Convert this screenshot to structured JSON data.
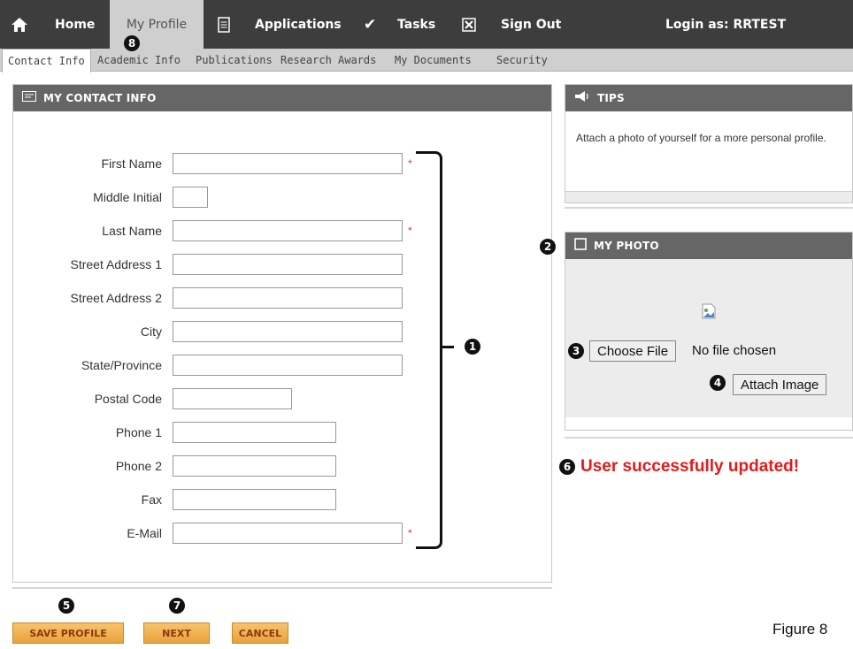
{
  "topnav": {
    "home": "Home",
    "my_profile": "My Profile",
    "applications": "Applications",
    "tasks": "Tasks",
    "sign_out": "Sign Out",
    "login": "Login as: RRTEST"
  },
  "subnav": [
    "Contact Info",
    "Academic Info",
    "Publications",
    "Research Awards",
    "My Documents",
    "Security"
  ],
  "contact": {
    "header": "MY CONTACT INFO",
    "fields": [
      {
        "label": "First Name",
        "value": "",
        "required": true
      },
      {
        "label": "Middle Initial",
        "value": "",
        "required": false
      },
      {
        "label": "Last Name",
        "value": "",
        "required": true
      },
      {
        "label": "Street Address 1",
        "value": "",
        "required": false
      },
      {
        "label": "Street Address 2",
        "value": "",
        "required": false
      },
      {
        "label": "City",
        "value": "",
        "required": false
      },
      {
        "label": "State/Province",
        "value": "",
        "required": false
      },
      {
        "label": "Postal Code",
        "value": "",
        "required": false
      },
      {
        "label": "Phone 1",
        "value": "",
        "required": false
      },
      {
        "label": "Phone 2",
        "value": "",
        "required": false
      },
      {
        "label": "Fax",
        "value": "",
        "required": false
      },
      {
        "label": "E-Mail",
        "value": "",
        "required": true
      }
    ],
    "required_mark": "*"
  },
  "tips": {
    "header": "TIPS",
    "text": "Attach a photo of yourself for a more personal profile."
  },
  "photo": {
    "header": "MY PHOTO",
    "choose_file": "Choose File",
    "no_file": "No file chosen",
    "attach": "Attach Image"
  },
  "status": {
    "message": "User successfully updated!"
  },
  "buttons": {
    "save": "SAVE PROFILE",
    "next": "NEXT",
    "cancel": "CANCEL"
  },
  "callouts": [
    "1",
    "2",
    "3",
    "4",
    "5",
    "6",
    "7",
    "8"
  ],
  "figure_label": "Figure 8",
  "colors": {
    "nav_bg": "#3d3d3d",
    "header_bg": "#666666",
    "accent_orange": "#e8a23b",
    "error_red": "#e21b1b"
  }
}
